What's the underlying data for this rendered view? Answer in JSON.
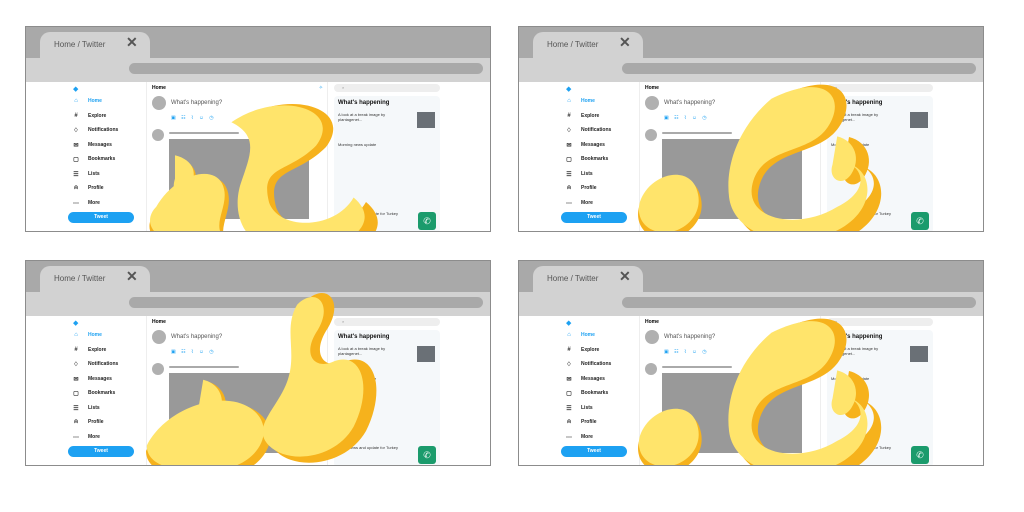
{
  "colors": {
    "chrome": "#a9a9a9",
    "tab": "#d2d2d2",
    "twitter_blue": "#1da1f2",
    "flame_outer": "#f6b21c",
    "flame_inner": "#ffe46b"
  },
  "tab": {
    "title": "Home / Twitter",
    "close": "✕"
  },
  "sidebar": {
    "logo_icon": "twitter-bird-icon",
    "items": [
      {
        "label": "Home",
        "icon": "home-icon",
        "glyph": "⌂"
      },
      {
        "label": "Explore",
        "icon": "hash-icon",
        "glyph": "#"
      },
      {
        "label": "Notifications",
        "icon": "bell-icon",
        "glyph": "♢"
      },
      {
        "label": "Messages",
        "icon": "mail-icon",
        "glyph": "✉"
      },
      {
        "label": "Bookmarks",
        "icon": "bookmark-icon",
        "glyph": "▢"
      },
      {
        "label": "Lists",
        "icon": "list-icon",
        "glyph": "☰"
      },
      {
        "label": "Profile",
        "icon": "profile-icon",
        "glyph": "⍝"
      },
      {
        "label": "More",
        "icon": "more-icon",
        "glyph": "⋯"
      }
    ],
    "tweet_button": "Tweet"
  },
  "timeline": {
    "header": "Home",
    "compose_placeholder": "What's happening?",
    "compose_tools": "▣ ☷ ⌇ ☺ ◷",
    "tweet_button": "Tweet"
  },
  "right_column": {
    "title": "What's happening",
    "trend_1": "A look at a break image by plantagenet...",
    "trend_2": "Morning news update",
    "wa_icon": "whatsapp-icon",
    "footer_text": "...Mr. News and update for Turkey"
  },
  "panels": [
    {
      "variant": 1,
      "flames": "left",
      "tweet_btn_visible": false
    },
    {
      "variant": 2,
      "flames": "right",
      "tweet_btn_visible": false
    },
    {
      "variant": 3,
      "flames": "center",
      "tweet_btn_visible": true
    },
    {
      "variant": 4,
      "flames": "right",
      "tweet_btn_visible": true
    }
  ]
}
